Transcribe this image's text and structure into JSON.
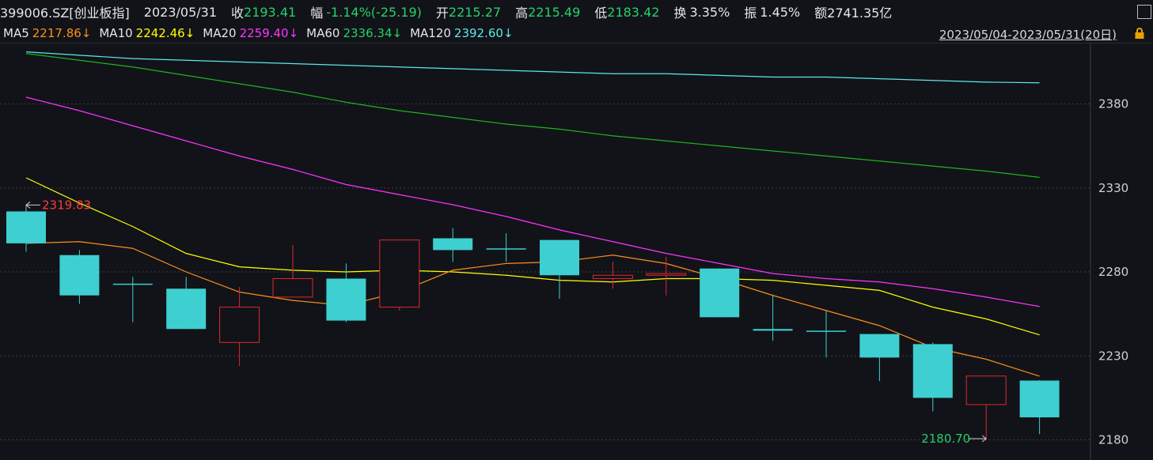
{
  "header": {
    "symbol": "399006.SZ[创业板指]",
    "date": "2023/05/31",
    "close_label": "收",
    "close_value": "2193.41",
    "change_label": "幅",
    "change_value": "-1.14%(-25.19)",
    "open_label": "开",
    "open_value": "2215.27",
    "high_label": "高",
    "high_value": "2215.49",
    "low_label": "低",
    "low_value": "2183.42",
    "turnover_label": "换",
    "turnover_value": "3.35%",
    "amplitude_label": "振",
    "amplitude_value": "1.45%",
    "amount_label": "额",
    "amount_value": "2741.35亿"
  },
  "ma_bar": {
    "ma5": {
      "label": "MA5",
      "value": "2217.86↓"
    },
    "ma10": {
      "label": "MA10",
      "value": "2242.46↓"
    },
    "ma20": {
      "label": "MA20",
      "value": "2259.40↓"
    },
    "ma60": {
      "label": "MA60",
      "value": "2336.34↓"
    },
    "ma120": {
      "label": "MA120",
      "value": "2392.60↓"
    },
    "range": "2023/05/04-2023/05/31(20日)"
  },
  "colors": {
    "up": "#e0282e",
    "down": "#3ecfd0",
    "ma5": "#ffffff",
    "ma10": "#ffff00",
    "ma20": "#ff00ff",
    "ma60": "#00c000",
    "ma120": "#40e0e0",
    "green_text": "#27d06a",
    "red_text": "#ff3b3b"
  },
  "chart_data": {
    "type": "candlestick",
    "y_ticks": [
      2180,
      2230,
      2280,
      2330,
      2380
    ],
    "ylim": [
      2168,
      2416
    ],
    "annotations": {
      "high": "2319.83",
      "low": "2180.70"
    },
    "candles": [
      {
        "open": 2316.0,
        "close": 2297.0,
        "high": 2319.8,
        "low": 2292.0
      },
      {
        "open": 2290.0,
        "close": 2266.0,
        "high": 2293.0,
        "low": 2261.0
      },
      {
        "open": 2273.0,
        "close": 2273.0,
        "high": 2277.0,
        "low": 2250.0
      },
      {
        "open": 2270.0,
        "close": 2246.0,
        "high": 2277.0,
        "low": 2246.0
      },
      {
        "open": 2238.0,
        "close": 2259.0,
        "high": 2271.0,
        "low": 2224.0
      },
      {
        "open": 2265.0,
        "close": 2276.0,
        "high": 2296.0,
        "low": 2265.0
      },
      {
        "open": 2276.0,
        "close": 2251.0,
        "high": 2285.0,
        "low": 2250.0
      },
      {
        "open": 2259.0,
        "close": 2299.0,
        "high": 2299.0,
        "low": 2257.0
      },
      {
        "open": 2300.0,
        "close": 2293.0,
        "high": 2306.0,
        "low": 2286.0
      },
      {
        "open": 2294.0,
        "close": 2294.0,
        "high": 2303.0,
        "low": 2286.0
      },
      {
        "open": 2299.0,
        "close": 2278.0,
        "high": 2299.0,
        "low": 2264.0
      },
      {
        "open": 2276.0,
        "close": 2278.0,
        "high": 2286.0,
        "low": 2270.0
      },
      {
        "open": 2278.0,
        "close": 2279.0,
        "high": 2289.0,
        "low": 2266.0
      },
      {
        "open": 2282.0,
        "close": 2253.0,
        "high": 2282.0,
        "low": 2253.0
      },
      {
        "open": 2246.0,
        "close": 2245.0,
        "high": 2266.0,
        "low": 2239.0
      },
      {
        "open": 2245.0,
        "close": 2245.0,
        "high": 2257.0,
        "low": 2229.0
      },
      {
        "open": 2243.0,
        "close": 2229.0,
        "high": 2243.0,
        "low": 2215.0
      },
      {
        "open": 2237.0,
        "close": 2205.0,
        "high": 2238.0,
        "low": 2197.0
      },
      {
        "open": 2201.0,
        "close": 2218.0,
        "high": 2218.0,
        "low": 2180.7
      },
      {
        "open": 2215.3,
        "close": 2193.4,
        "high": 2215.5,
        "low": 2183.4
      }
    ],
    "ma5": [
      2297.0,
      2298.0,
      2294.0,
      2280.0,
      2268.0,
      2263.0,
      2260.0,
      2268.0,
      2281.0,
      2285.0,
      2286.0,
      2290.0,
      2285.0,
      2276.0,
      2266.0,
      2257.0,
      2248.0,
      2235.0,
      2228.0,
      2217.9
    ],
    "ma10": [
      2336.0,
      2321.0,
      2307.0,
      2291.0,
      2283.0,
      2281.0,
      2280.0,
      2281.0,
      2280.0,
      2278.0,
      2275.0,
      2274.0,
      2276.0,
      2276.0,
      2275.0,
      2272.0,
      2269.0,
      2259.0,
      2252.0,
      2242.5
    ],
    "ma20": [
      2384.0,
      2376.0,
      2367.0,
      2358.0,
      2349.0,
      2341.0,
      2332.0,
      2326.0,
      2320.0,
      2313.0,
      2305.0,
      2298.0,
      2291.0,
      2285.0,
      2279.0,
      2276.0,
      2274.0,
      2270.0,
      2265.0,
      2259.4
    ],
    "ma60": [
      2410.0,
      2406.0,
      2402.0,
      2397.0,
      2392.0,
      2387.0,
      2381.0,
      2376.0,
      2372.0,
      2368.0,
      2365.0,
      2361.0,
      2358.0,
      2355.0,
      2352.0,
      2349.0,
      2346.0,
      2343.0,
      2340.0,
      2336.3
    ],
    "ma120": [
      2411.0,
      2409.0,
      2407.0,
      2406.0,
      2405.0,
      2404.0,
      2403.0,
      2402.0,
      2401.0,
      2400.0,
      2399.0,
      2398.0,
      2398.0,
      2397.0,
      2396.0,
      2396.0,
      2395.0,
      2394.0,
      2393.0,
      2392.6
    ]
  }
}
